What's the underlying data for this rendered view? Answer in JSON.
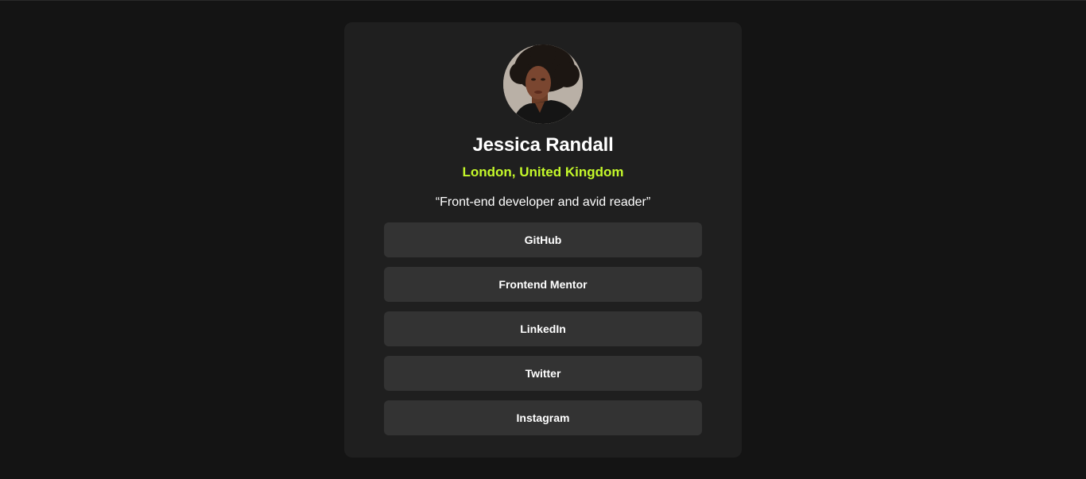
{
  "profile": {
    "name": "Jessica Randall",
    "location": "London, United Kingdom",
    "bio": "“Front-end developer and avid reader”",
    "avatar_icon": "avatar-photo"
  },
  "links": [
    {
      "label": "GitHub"
    },
    {
      "label": "Frontend Mentor"
    },
    {
      "label": "LinkedIn"
    },
    {
      "label": "Twitter"
    },
    {
      "label": "Instagram"
    }
  ],
  "colors": {
    "background": "#141414",
    "card": "#1f1f1f",
    "button": "#333333",
    "accent": "#c4f82a",
    "text": "#ffffff"
  }
}
